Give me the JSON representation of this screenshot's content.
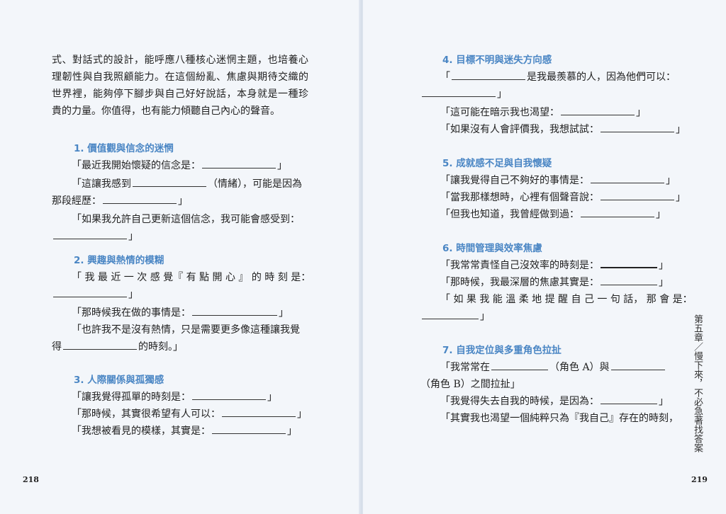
{
  "left": {
    "intro": "式、對話式的設計，能呼應八種核心迷惘主題，也培養心理韌性與自我照顧能力。在這個紛亂、焦慮與期待交織的世界裡，能夠停下腳步與自己好好說話，本身就是一種珍貴的力量。你值得，也有能力傾聽自己內心的聲音。",
    "s1": {
      "title": "1. 價值觀與信念的迷惘",
      "a": "「最近我開始懷疑的信念是：",
      "b1": "「這讓我感到",
      "b2": "（情緒），可能是因為",
      "b3": "那段經歷：",
      "b4": "」",
      "c1": "「如果我允許自己更新這個信念，我可能會感受到：",
      "c2": "」"
    },
    "s2": {
      "title": "2. 興趣與熱情的模糊",
      "a1": "「 我 最 近 一 次 感 覺『 有 點 開 心 』 的 時 刻 是：",
      "a2": "」",
      "b": "「那時候我在做的事情是：",
      "c1": "「也許我不是沒有熱情，只是需要更多像這種讓我覺",
      "c2": "得",
      "c3": "的時刻。」"
    },
    "s3": {
      "title": "3. 人際關係與孤獨感",
      "a": "「讓我覺得孤單的時刻是：",
      "b": "「那時候，其實很希望有人可以：",
      "c": "「我想被看見的模樣，其實是："
    },
    "close": "」",
    "page_number": "218"
  },
  "right": {
    "s4": {
      "title": "4. 目標不明與迷失方向感",
      "a1": "「",
      "a2": "是我最羨慕的人，因為他們可以：",
      "a3": "」",
      "b": "「這可能在暗示我也渴望：",
      "c": "「如果沒有人會評價我，我想試試："
    },
    "s5": {
      "title": "5. 成就感不足與自我懷疑",
      "a": "「讓我覺得自己不夠好的事情是：",
      "b": "「當我那樣想時，心裡有個聲音說：",
      "c": "「但我也知道，我曾經做到過："
    },
    "s6": {
      "title": "6. 時間管理與效率焦慮",
      "a": "「我常常責怪自己沒效率的時刻是：",
      "b": "「那時候，我最深層的焦慮其實是：",
      "c1": "「 如 果 我 能 溫 柔 地 提 醒 自 己 一 句 話， 那 會 是：",
      "c2": "」"
    },
    "s7": {
      "title": "7. 自我定位與多重角色拉扯",
      "a1": "「我常常在",
      "a2": "（角色 A）與",
      "a3": "（角色 B）之間拉扯」",
      "b": "「我覺得失去自我的時候，是因為：",
      "c": "「其實我也渴望一個純粹只為『我自己』存在的時刻，"
    },
    "close": "」",
    "runner": "第五章／慢下來，不必急著找答案",
    "page_number": "219"
  }
}
